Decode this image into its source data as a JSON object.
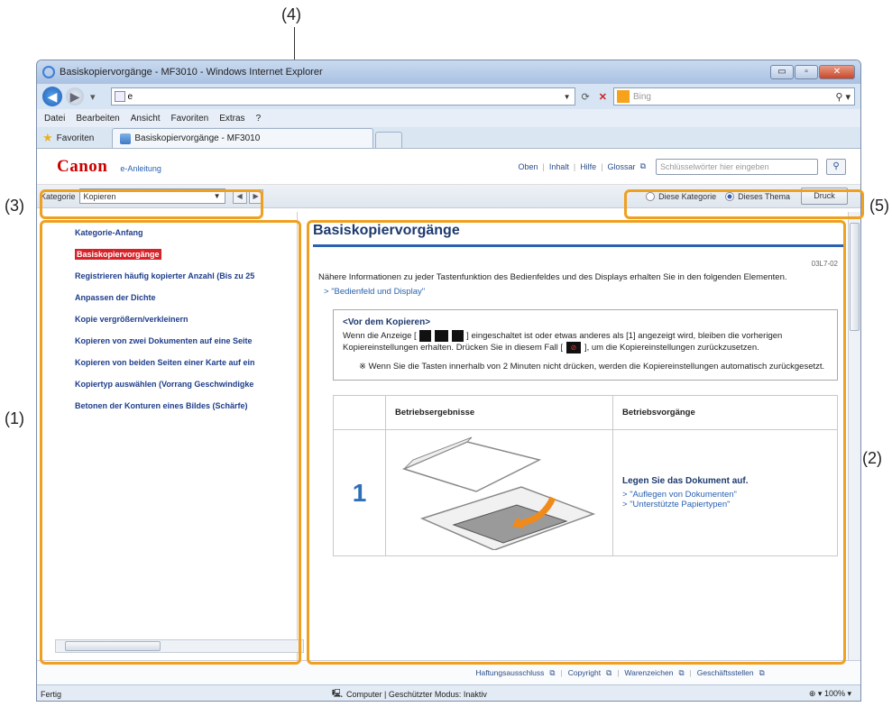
{
  "callouts": [
    "(1)",
    "(2)",
    "(3)",
    "(4)",
    "(5)"
  ],
  "window": {
    "title": "Basiskopiervorgänge - MF3010 - Windows Internet Explorer",
    "buttons": [
      "▭",
      "▫",
      "✕"
    ]
  },
  "browser": {
    "address": "e",
    "search_placeholder": "Bing",
    "menu": [
      "Datei",
      "Bearbeiten",
      "Ansicht",
      "Favoriten",
      "Extras",
      "?"
    ],
    "favorites_label": "Favoriten",
    "tab_label": "Basiskopiervorgänge - MF3010"
  },
  "header": {
    "logo": "Canon",
    "sublogo": "e-Anleitung",
    "links": [
      "Oben",
      "Inhalt",
      "Hilfe",
      "Glossar"
    ],
    "search_placeholder": "Schlüsselwörter hier eingeben"
  },
  "catbar": {
    "label": "Kategorie",
    "selected": "Kopieren",
    "scope_options": [
      "Diese Kategorie",
      "Dieses Thema"
    ],
    "scope_selected": "Dieses Thema",
    "print_label": "Druck"
  },
  "sidebar": {
    "items": [
      {
        "label": "Kategorie-Anfang",
        "active": false
      },
      {
        "label": "Basiskopiervorgänge",
        "active": true
      },
      {
        "label": "Registrieren häufig kopierter Anzahl (Bis zu 25",
        "active": false
      },
      {
        "label": "Anpassen der Dichte",
        "active": false
      },
      {
        "label": "Kopie vergrößern/verkleinern",
        "active": false
      },
      {
        "label": "Kopieren von zwei Dokumenten auf eine Seite",
        "active": false
      },
      {
        "label": "Kopieren von beiden Seiten einer Karte auf ein",
        "active": false
      },
      {
        "label": "Kopiertyp auswählen (Vorrang Geschwindigke",
        "active": false
      },
      {
        "label": "Betonen der Konturen eines Bildes (Schärfe)",
        "active": false
      }
    ]
  },
  "main": {
    "title": "Basiskopiervorgänge",
    "doc_id": "03L7-02",
    "intro": "Nähere Informationen zu jeder Tastenfunktion des Bedienfeldes und des Displays erhalten Sie in den folgenden Elementen.",
    "intro_link": "\"Bedienfeld und Display\"",
    "note_title": "<Vor dem Kopieren>",
    "note_text_1": "Wenn die Anzeige [",
    "note_text_2": "] eingeschaltet ist oder etwas anderes als [1] angezeigt wird, bleiben die vorherigen Kopiereinstellungen erhalten. Drücken Sie in diesem Fall [",
    "note_text_3": "], um die Kopiereinstellungen zurückzusetzen.",
    "note_sub": "※ Wenn Sie die Tasten innerhalb von 2 Minuten nicht drücken, werden die Kopiereinstellungen automatisch zurückgesetzt.",
    "table_headers": [
      "",
      "Betriebsergebnisse",
      "Betriebsvorgänge"
    ],
    "step_number": "1",
    "step_title": "Legen Sie das Dokument auf.",
    "step_links": [
      "\"Auflegen von Dokumenten\"",
      "\"Unterstützte Papiertypen\""
    ]
  },
  "footer": {
    "links": [
      "Haftungsausschluss",
      "Copyright",
      "Warenzeichen",
      "Geschäftsstellen"
    ]
  },
  "status": {
    "left": "Fertig",
    "zone": "Computer | Geschützter Modus: Inaktiv",
    "zoom": "100%"
  }
}
